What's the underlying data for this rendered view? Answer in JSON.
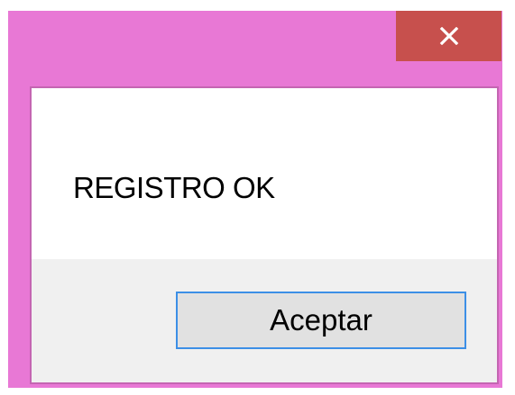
{
  "dialog": {
    "close_icon": "close-icon",
    "message": "REGISTRO OK",
    "ok_label": "Aceptar"
  },
  "colors": {
    "frame": "#e878d5",
    "close_button": "#c7504d",
    "button_border": "#3c8fe6",
    "button_area": "#f0f0f0"
  }
}
